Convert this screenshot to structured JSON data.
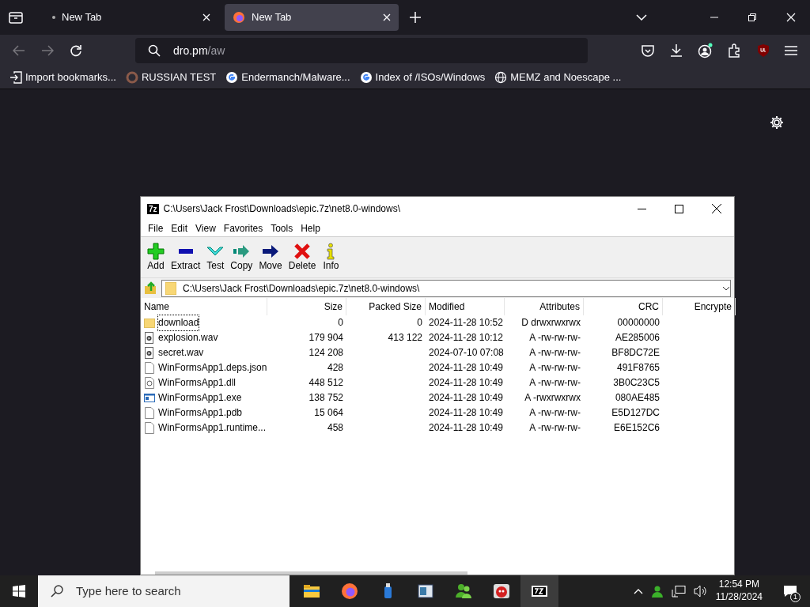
{
  "browser": {
    "tabs": [
      {
        "title": "New Tab",
        "selected": false,
        "kind": "dot"
      },
      {
        "title": "New Tab",
        "selected": true,
        "kind": "firefox"
      }
    ],
    "address": {
      "host": "dro.pm",
      "path": "/aw"
    },
    "bookmarks": [
      {
        "label": "Import bookmarks...",
        "kind": "import"
      },
      {
        "label": "RUSSIAN TEST",
        "kind": "ring"
      },
      {
        "label": "Endermanch/Malware...",
        "kind": "google"
      },
      {
        "label": "Index of /ISOs/Windows",
        "kind": "google"
      },
      {
        "label": "MEMZ and Noescape ...",
        "kind": "globe"
      }
    ]
  },
  "window": {
    "title": "C:\\Users\\Jack Frost\\Downloads\\epic.7z\\net8.0-windows\\",
    "logo": "7z",
    "menu": [
      "File",
      "Edit",
      "View",
      "Favorites",
      "Tools",
      "Help"
    ],
    "toolbar": [
      {
        "label": "Add",
        "kind": "add"
      },
      {
        "label": "Extract",
        "kind": "extract"
      },
      {
        "label": "Test",
        "kind": "test"
      },
      {
        "label": "Copy",
        "kind": "copy"
      },
      {
        "label": "Move",
        "kind": "move"
      },
      {
        "label": "Delete",
        "kind": "delete"
      },
      {
        "label": "Info",
        "kind": "info"
      }
    ],
    "path": "C:\\Users\\Jack Frost\\Downloads\\epic.7z\\net8.0-windows\\",
    "columns": [
      "Name",
      "Size",
      "Packed Size",
      "Modified",
      "Attributes",
      "CRC",
      "Encrypte"
    ],
    "rows": [
      {
        "kind": "folder",
        "focused": true,
        "cells": [
          "download",
          "0",
          "0",
          "2024-11-28 10:52",
          "D drwxrwxrwx",
          "00000000"
        ]
      },
      {
        "kind": "audio",
        "focused": false,
        "cells": [
          "explosion.wav",
          "179 904",
          "413 122",
          "2024-11-28 10:12",
          "A -rw-rw-rw-",
          "AE285006"
        ]
      },
      {
        "kind": "audio",
        "focused": false,
        "cells": [
          "secret.wav",
          "124 208",
          "",
          "2024-07-10 07:08",
          "A -rw-rw-rw-",
          "BF8DC72E"
        ]
      },
      {
        "kind": "file",
        "focused": false,
        "cells": [
          "WinFormsApp1.deps.json",
          "428",
          "",
          "2024-11-28 10:49",
          "A -rw-rw-rw-",
          "491F8765"
        ]
      },
      {
        "kind": "dll",
        "focused": false,
        "cells": [
          "WinFormsApp1.dll",
          "448 512",
          "",
          "2024-11-28 10:49",
          "A -rw-rw-rw-",
          "3B0C23C5"
        ]
      },
      {
        "kind": "exe",
        "focused": false,
        "cells": [
          "WinFormsApp1.exe",
          "138 752",
          "",
          "2024-11-28 10:49",
          "A -rwxrwxrwx",
          "080AE485"
        ]
      },
      {
        "kind": "file",
        "focused": false,
        "cells": [
          "WinFormsApp1.pdb",
          "15 064",
          "",
          "2024-11-28 10:49",
          "A -rw-rw-rw-",
          "E5D127DC"
        ]
      },
      {
        "kind": "file",
        "focused": false,
        "cells": [
          "WinFormsApp1.runtime...",
          "458",
          "",
          "2024-11-28 10:49",
          "A -rw-rw-rw-",
          "E6E152C6"
        ]
      }
    ]
  },
  "taskbar": {
    "search_placeholder": "Type here to search",
    "apps": [
      {
        "kind": "folder",
        "active": false
      },
      {
        "kind": "firefox",
        "active": false
      },
      {
        "kind": "usb",
        "active": false
      },
      {
        "kind": "window",
        "active": false
      },
      {
        "kind": "people",
        "active": false
      },
      {
        "kind": "bird",
        "active": false
      },
      {
        "kind": "archive",
        "active": true
      }
    ],
    "time": "12:54 PM",
    "date": "11/28/2024",
    "notifications": "1"
  }
}
